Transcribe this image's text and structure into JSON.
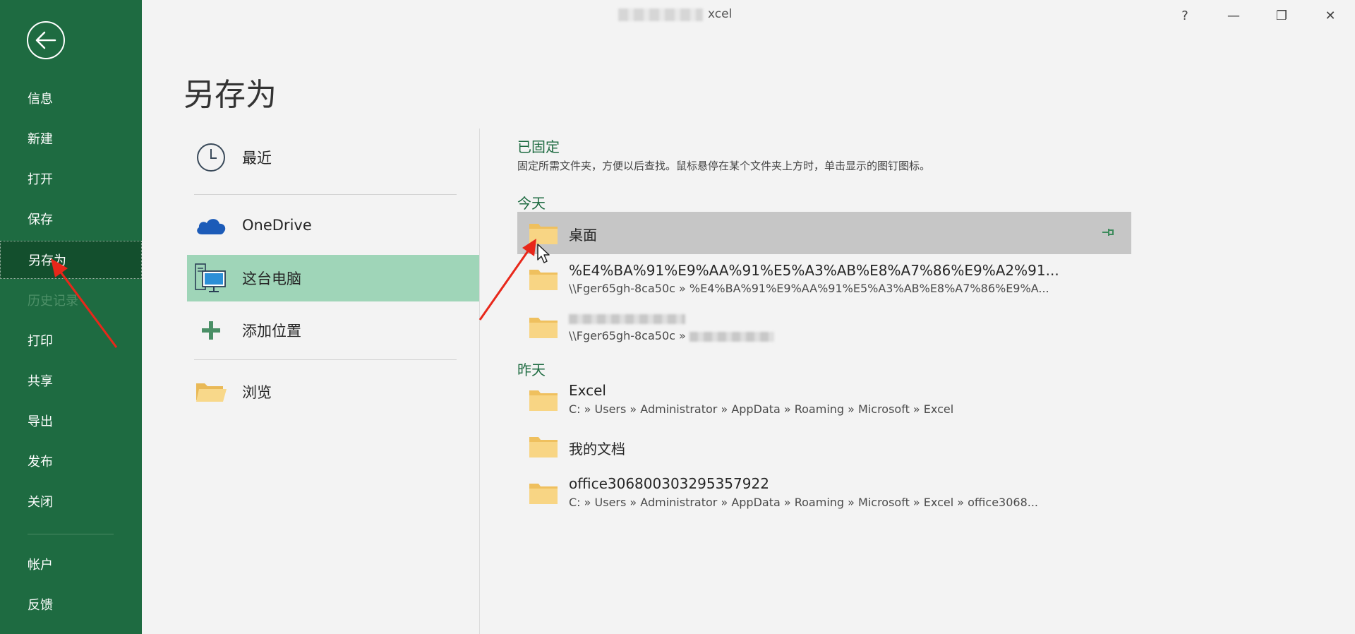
{
  "window": {
    "title_suffix": "xcel",
    "help": "?",
    "minimize": "—",
    "restore": "❐",
    "close": "✕"
  },
  "nav": {
    "items": [
      {
        "label": "信息",
        "state": "normal"
      },
      {
        "label": "新建",
        "state": "normal"
      },
      {
        "label": "打开",
        "state": "normal"
      },
      {
        "label": "保存",
        "state": "normal"
      },
      {
        "label": "另存为",
        "state": "selected"
      },
      {
        "label": "历史记录",
        "state": "disabled"
      },
      {
        "label": "打印",
        "state": "normal"
      },
      {
        "label": "共享",
        "state": "normal"
      },
      {
        "label": "导出",
        "state": "normal"
      },
      {
        "label": "发布",
        "state": "normal"
      },
      {
        "label": "关闭",
        "state": "normal"
      }
    ],
    "bottom_items": [
      {
        "label": "帐户"
      },
      {
        "label": "反馈"
      }
    ]
  },
  "page": {
    "title": "另存为"
  },
  "locations": [
    {
      "label": "最近",
      "icon": "clock-icon"
    },
    {
      "label": "OneDrive",
      "icon": "onedrive-cloud-icon"
    },
    {
      "label": "这台电脑",
      "icon": "this-pc-icon",
      "selected": true
    },
    {
      "label": "添加位置",
      "icon": "plus-icon"
    },
    {
      "label": "浏览",
      "icon": "open-folder-icon"
    }
  ],
  "pinned": {
    "heading": "已固定",
    "hint": "固定所需文件夹，方便以后查找。鼠标悬停在某个文件夹上方时，单击显示的图钉图标。"
  },
  "today": {
    "heading": "今天",
    "folders": [
      {
        "name": "桌面",
        "path": ""
      },
      {
        "name": "%E4%BA%91%E9%AA%91%E5%A3%AB%E8%A7%86%E9%A2%91...",
        "path": "\\\\Fger65gh-8ca50c » %E4%BA%91%E9%AA%91%E5%A3%AB%E8%A7%86%E9%A..."
      },
      {
        "name": "",
        "path": "\\\\Fger65gh-8ca50c »"
      }
    ]
  },
  "yesterday": {
    "heading": "昨天",
    "folders": [
      {
        "name": "Excel",
        "path": "C: » Users » Administrator » AppData » Roaming » Microsoft » Excel"
      },
      {
        "name": "我的文档",
        "path": ""
      },
      {
        "name": "office306800303295357922",
        "path": "C: » Users » Administrator » AppData » Roaming » Microsoft » Excel » office3068..."
      }
    ]
  },
  "colors": {
    "nav_bg": "#1e6b41",
    "nav_selected": "#134f2d",
    "location_selected": "#9fd5b8",
    "accent_text": "#1e6b41",
    "folder_yellow": "#f5c96a",
    "annotation_red": "#e8271a"
  }
}
